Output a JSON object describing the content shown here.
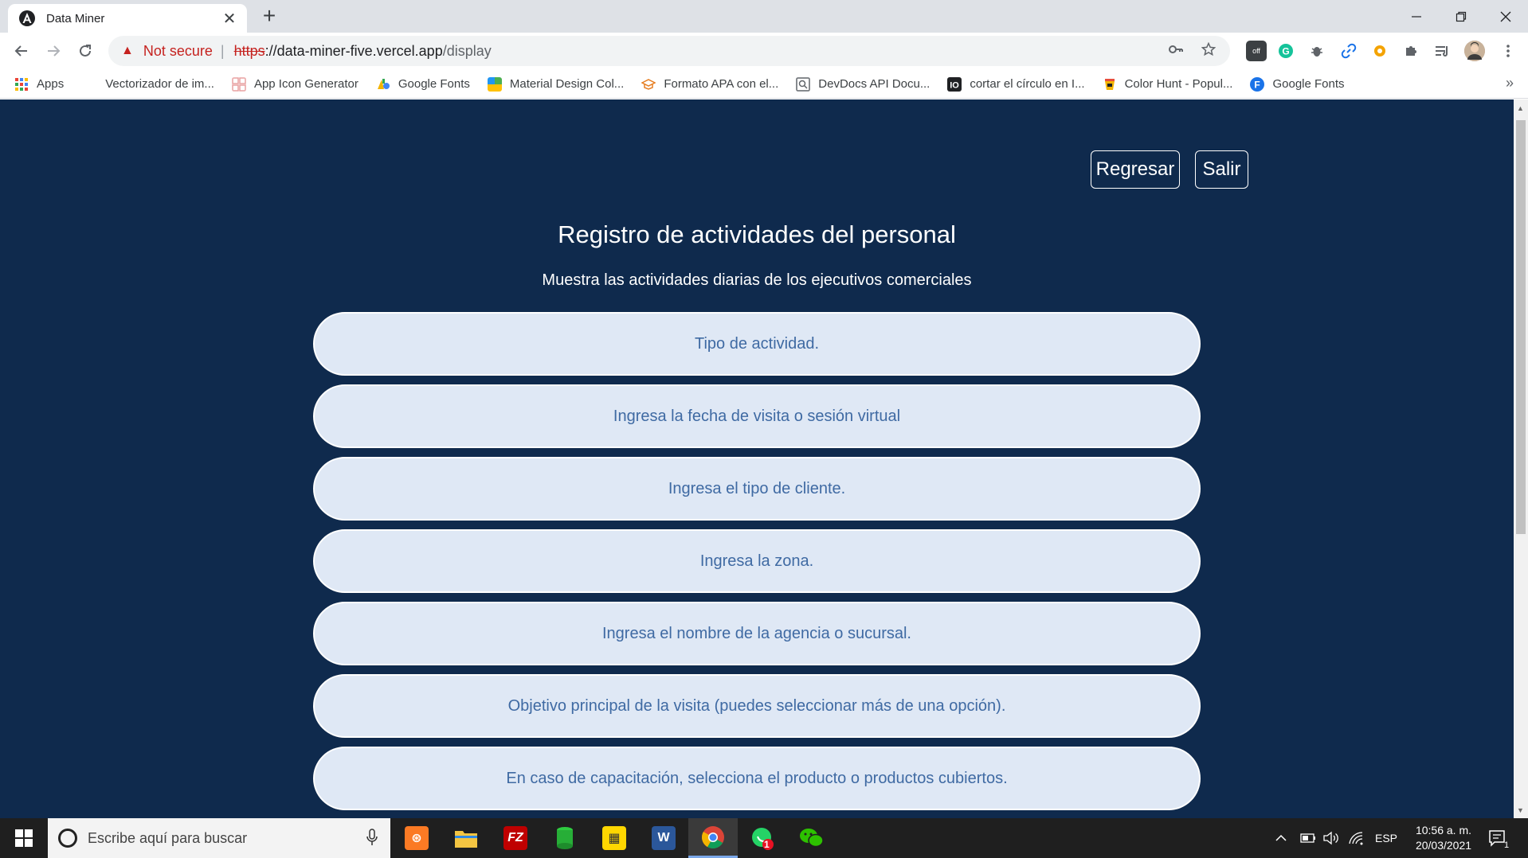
{
  "browser": {
    "tab_title": "Data Miner",
    "tab_close": "✕",
    "new_tab": "+",
    "address": {
      "security_label": "Not secure",
      "scheme": "https",
      "host": "://data-miner-five.vercel.app",
      "path": "/display"
    },
    "bookmarks": [
      {
        "label": "Apps",
        "icon": "apps-grid-icon",
        "color": "#4285f4"
      },
      {
        "label": "Vectorizador de im...",
        "icon": "",
        "color": ""
      },
      {
        "label": "App Icon Generator",
        "icon": "app-icon-generator-icon",
        "color": "#e8a0a0"
      },
      {
        "label": "Google Fonts",
        "icon": "google-fonts-icon",
        "color": "#f4b400"
      },
      {
        "label": "Material Design Col...",
        "icon": "material-palette-icon",
        "color": "#2196f3"
      },
      {
        "label": "Formato APA con el...",
        "icon": "apa-icon",
        "color": "#e67e22"
      },
      {
        "label": "DevDocs API Docu...",
        "icon": "devdocs-icon",
        "color": "#5f6368"
      },
      {
        "label": "cortar el círculo en I...",
        "icon": "io-icon",
        "color": "#202124"
      },
      {
        "label": "Color Hunt - Popul...",
        "icon": "color-hunt-icon",
        "color": "#f4b400"
      },
      {
        "label": "Google Fonts",
        "icon": "google-fonts-f-icon",
        "color": "#1a73e8"
      }
    ],
    "bookmarks_more": "»"
  },
  "page": {
    "back_button": "Regresar",
    "exit_button": "Salir",
    "title": "Registro de actividades del personal",
    "subtitle": "Muestra las actividades diarias de los ejecutivos comerciales",
    "options": [
      "Tipo de actividad.",
      "Ingresa la fecha de visita o sesión virtual",
      "Ingresa el tipo de cliente.",
      "Ingresa la zona.",
      "Ingresa el nombre de la agencia o sucursal.",
      "Objetivo principal de la visita (puedes seleccionar más de una opción).",
      "En caso de capacitación, selecciona el producto o productos cubiertos."
    ]
  },
  "taskbar": {
    "search_placeholder": "Escribe aquí para buscar",
    "language": "ESP",
    "time": "10:56 a. m.",
    "date": "20/03/2021",
    "whatsapp_badge": "1",
    "notification_count": "1"
  },
  "colors": {
    "page_background": "#0f2a4d",
    "pill_background": "#dfe8f5",
    "pill_text": "#3f6aa3"
  }
}
